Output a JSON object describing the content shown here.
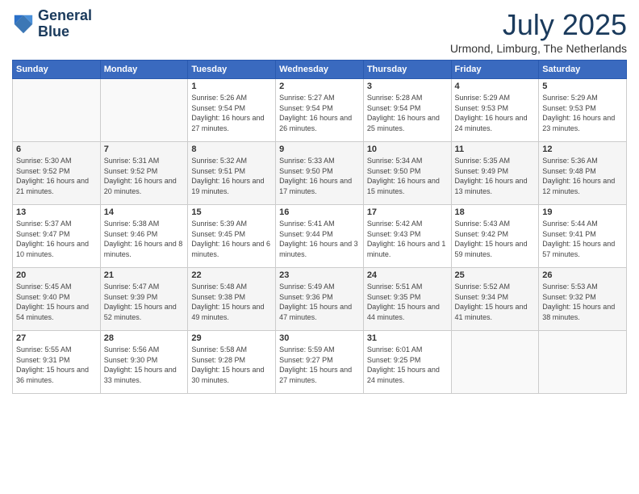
{
  "logo": {
    "line1": "General",
    "line2": "Blue"
  },
  "title": "July 2025",
  "subtitle": "Urmond, Limburg, The Netherlands",
  "weekdays": [
    "Sunday",
    "Monday",
    "Tuesday",
    "Wednesday",
    "Thursday",
    "Friday",
    "Saturday"
  ],
  "weeks": [
    [
      {
        "day": "",
        "sunrise": "",
        "sunset": "",
        "daylight": ""
      },
      {
        "day": "",
        "sunrise": "",
        "sunset": "",
        "daylight": ""
      },
      {
        "day": "1",
        "sunrise": "Sunrise: 5:26 AM",
        "sunset": "Sunset: 9:54 PM",
        "daylight": "Daylight: 16 hours and 27 minutes."
      },
      {
        "day": "2",
        "sunrise": "Sunrise: 5:27 AM",
        "sunset": "Sunset: 9:54 PM",
        "daylight": "Daylight: 16 hours and 26 minutes."
      },
      {
        "day": "3",
        "sunrise": "Sunrise: 5:28 AM",
        "sunset": "Sunset: 9:54 PM",
        "daylight": "Daylight: 16 hours and 25 minutes."
      },
      {
        "day": "4",
        "sunrise": "Sunrise: 5:29 AM",
        "sunset": "Sunset: 9:53 PM",
        "daylight": "Daylight: 16 hours and 24 minutes."
      },
      {
        "day": "5",
        "sunrise": "Sunrise: 5:29 AM",
        "sunset": "Sunset: 9:53 PM",
        "daylight": "Daylight: 16 hours and 23 minutes."
      }
    ],
    [
      {
        "day": "6",
        "sunrise": "Sunrise: 5:30 AM",
        "sunset": "Sunset: 9:52 PM",
        "daylight": "Daylight: 16 hours and 21 minutes."
      },
      {
        "day": "7",
        "sunrise": "Sunrise: 5:31 AM",
        "sunset": "Sunset: 9:52 PM",
        "daylight": "Daylight: 16 hours and 20 minutes."
      },
      {
        "day": "8",
        "sunrise": "Sunrise: 5:32 AM",
        "sunset": "Sunset: 9:51 PM",
        "daylight": "Daylight: 16 hours and 19 minutes."
      },
      {
        "day": "9",
        "sunrise": "Sunrise: 5:33 AM",
        "sunset": "Sunset: 9:50 PM",
        "daylight": "Daylight: 16 hours and 17 minutes."
      },
      {
        "day": "10",
        "sunrise": "Sunrise: 5:34 AM",
        "sunset": "Sunset: 9:50 PM",
        "daylight": "Daylight: 16 hours and 15 minutes."
      },
      {
        "day": "11",
        "sunrise": "Sunrise: 5:35 AM",
        "sunset": "Sunset: 9:49 PM",
        "daylight": "Daylight: 16 hours and 13 minutes."
      },
      {
        "day": "12",
        "sunrise": "Sunrise: 5:36 AM",
        "sunset": "Sunset: 9:48 PM",
        "daylight": "Daylight: 16 hours and 12 minutes."
      }
    ],
    [
      {
        "day": "13",
        "sunrise": "Sunrise: 5:37 AM",
        "sunset": "Sunset: 9:47 PM",
        "daylight": "Daylight: 16 hours and 10 minutes."
      },
      {
        "day": "14",
        "sunrise": "Sunrise: 5:38 AM",
        "sunset": "Sunset: 9:46 PM",
        "daylight": "Daylight: 16 hours and 8 minutes."
      },
      {
        "day": "15",
        "sunrise": "Sunrise: 5:39 AM",
        "sunset": "Sunset: 9:45 PM",
        "daylight": "Daylight: 16 hours and 6 minutes."
      },
      {
        "day": "16",
        "sunrise": "Sunrise: 5:41 AM",
        "sunset": "Sunset: 9:44 PM",
        "daylight": "Daylight: 16 hours and 3 minutes."
      },
      {
        "day": "17",
        "sunrise": "Sunrise: 5:42 AM",
        "sunset": "Sunset: 9:43 PM",
        "daylight": "Daylight: 16 hours and 1 minute."
      },
      {
        "day": "18",
        "sunrise": "Sunrise: 5:43 AM",
        "sunset": "Sunset: 9:42 PM",
        "daylight": "Daylight: 15 hours and 59 minutes."
      },
      {
        "day": "19",
        "sunrise": "Sunrise: 5:44 AM",
        "sunset": "Sunset: 9:41 PM",
        "daylight": "Daylight: 15 hours and 57 minutes."
      }
    ],
    [
      {
        "day": "20",
        "sunrise": "Sunrise: 5:45 AM",
        "sunset": "Sunset: 9:40 PM",
        "daylight": "Daylight: 15 hours and 54 minutes."
      },
      {
        "day": "21",
        "sunrise": "Sunrise: 5:47 AM",
        "sunset": "Sunset: 9:39 PM",
        "daylight": "Daylight: 15 hours and 52 minutes."
      },
      {
        "day": "22",
        "sunrise": "Sunrise: 5:48 AM",
        "sunset": "Sunset: 9:38 PM",
        "daylight": "Daylight: 15 hours and 49 minutes."
      },
      {
        "day": "23",
        "sunrise": "Sunrise: 5:49 AM",
        "sunset": "Sunset: 9:36 PM",
        "daylight": "Daylight: 15 hours and 47 minutes."
      },
      {
        "day": "24",
        "sunrise": "Sunrise: 5:51 AM",
        "sunset": "Sunset: 9:35 PM",
        "daylight": "Daylight: 15 hours and 44 minutes."
      },
      {
        "day": "25",
        "sunrise": "Sunrise: 5:52 AM",
        "sunset": "Sunset: 9:34 PM",
        "daylight": "Daylight: 15 hours and 41 minutes."
      },
      {
        "day": "26",
        "sunrise": "Sunrise: 5:53 AM",
        "sunset": "Sunset: 9:32 PM",
        "daylight": "Daylight: 15 hours and 38 minutes."
      }
    ],
    [
      {
        "day": "27",
        "sunrise": "Sunrise: 5:55 AM",
        "sunset": "Sunset: 9:31 PM",
        "daylight": "Daylight: 15 hours and 36 minutes."
      },
      {
        "day": "28",
        "sunrise": "Sunrise: 5:56 AM",
        "sunset": "Sunset: 9:30 PM",
        "daylight": "Daylight: 15 hours and 33 minutes."
      },
      {
        "day": "29",
        "sunrise": "Sunrise: 5:58 AM",
        "sunset": "Sunset: 9:28 PM",
        "daylight": "Daylight: 15 hours and 30 minutes."
      },
      {
        "day": "30",
        "sunrise": "Sunrise: 5:59 AM",
        "sunset": "Sunset: 9:27 PM",
        "daylight": "Daylight: 15 hours and 27 minutes."
      },
      {
        "day": "31",
        "sunrise": "Sunrise: 6:01 AM",
        "sunset": "Sunset: 9:25 PM",
        "daylight": "Daylight: 15 hours and 24 minutes."
      },
      {
        "day": "",
        "sunrise": "",
        "sunset": "",
        "daylight": ""
      },
      {
        "day": "",
        "sunrise": "",
        "sunset": "",
        "daylight": ""
      }
    ]
  ]
}
